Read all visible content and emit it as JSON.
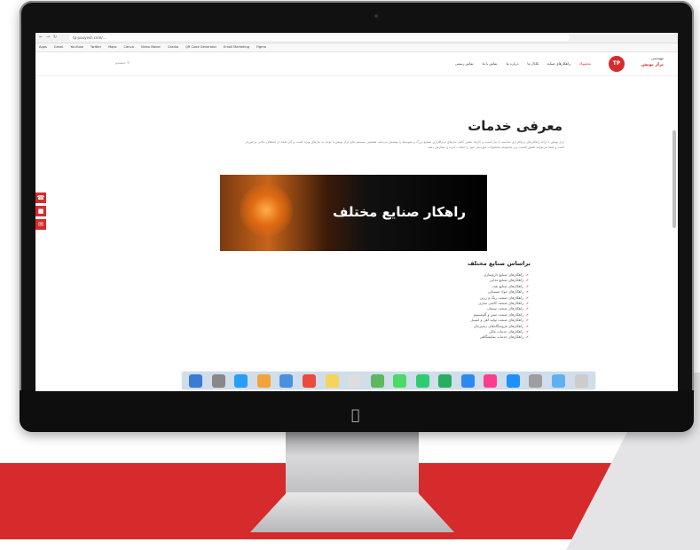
{
  "colors": {
    "accent": "#d62b2d",
    "screen_bg": "#ffffff",
    "bezel": "#111111"
  },
  "browser": {
    "url": "tp-pouyesh.com/...",
    "bookmarks": [
      "Apps",
      "Gmail",
      "YouTube",
      "Twitter",
      "Maps",
      "Canva",
      "Video Maker",
      "Gradio",
      "QR Code Generator",
      "Email Marketing",
      "Figma"
    ]
  },
  "site": {
    "logo_badge": "TP",
    "logo_line1": "مهندسی",
    "logo_line2": "تراز پویش",
    "menu": [
      "محصولات",
      "راهکارهای صنایع",
      "کانال ما",
      "درباره ما",
      "تماس با ما",
      "تماس رسمی"
    ],
    "search_placeholder": "جستجو"
  },
  "main": {
    "title": "معرفی خدمات",
    "intro": "تراز پویش با ارائه راهکارهای نرم‌افزاری مناسب با نیاز کسب و کارها، بخش کامل نیازهای نرم‌افزاری صنایع بزرگ و متوسط را پوشش می‌دهد. همچنین سیستم های تراز پویش با توجه به نیازهای ویژه کسب و کار شما، از انعطاف بالایی برخوردار است و شما می‌توانید تلفیق کیست زیر مجموعه محصولات موردنیاز خود را انتخاب کرده و سفارش دهید.",
    "banner_text": "راهکار صنایع مختلف",
    "list_title": "براساس صنایع مختلف",
    "list": [
      "راهکارهای صنایع داروسازی",
      "راهکارهای صنایع غذایی",
      "راهکارهای صنایع نفت",
      "راهکارهای مواد شیمیایی",
      "راهکارهای صنعت رنگ و رزین",
      "راهکارهای صنعت کاشی سازی",
      "راهکارهای صنعت سیمان",
      "راهکارهای صنعت مس و آلومینیوم",
      "راهکارهای صنعت تولید آهن و استیل",
      "راهکارهای فروشگاه‌های زنجیره‌ای",
      "راهکارهای خدمات مالی",
      "راهکارهای خدمات نمایشگاهی"
    ]
  },
  "side_buttons": [
    "phone-icon",
    "chat-icon",
    "mail-icon"
  ],
  "dock_icons": [
    "finder-icon",
    "launchpad-icon",
    "safari-icon",
    "photos-icon",
    "mail-app-icon",
    "calendar-icon",
    "notes-icon",
    "reminders-icon",
    "maps-icon",
    "messages-icon",
    "facetime-icon",
    "numbers-icon",
    "keynote-icon",
    "itunes-icon",
    "appstore-icon",
    "preferences-icon",
    "folder-icon",
    "trash-icon"
  ]
}
